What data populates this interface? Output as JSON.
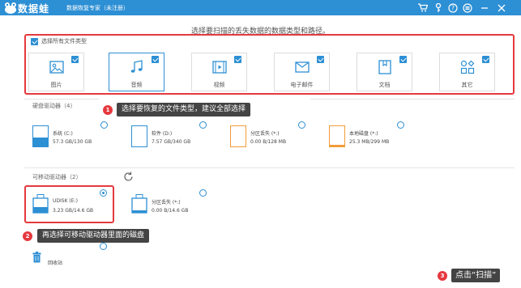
{
  "app": {
    "name": "数据蛙",
    "subtitle": "数据恢复专家（未注册）"
  },
  "heading": "选择要扫描的丢失数据的数据类型和路径。",
  "select_all": "选择所有文件类型",
  "file_types": [
    {
      "label": "图片",
      "icon": "image-icon",
      "checked": true
    },
    {
      "label": "音频",
      "icon": "audio-icon",
      "checked": true
    },
    {
      "label": "视频",
      "icon": "video-icon",
      "checked": true
    },
    {
      "label": "电子邮件",
      "icon": "email-icon",
      "checked": true
    },
    {
      "label": "文档",
      "icon": "document-icon",
      "checked": true
    },
    {
      "label": "其它",
      "icon": "other-icon",
      "checked": true
    }
  ],
  "hard_drives": {
    "title": "硬盘驱动器（4）",
    "items": [
      {
        "name": "系统 (C:)",
        "size": "57.3 GB/130 GB",
        "fill": 0.44,
        "color": "#2d8fd4"
      },
      {
        "name": "软件 (D:)",
        "size": "7.57 GB/340 GB",
        "fill": 0.02,
        "color": "#2d8fd4"
      },
      {
        "name": "分区丢失 (*:)",
        "size": "0.00 B/128 MB",
        "fill": 0.0,
        "color": "#f39c3a"
      },
      {
        "name": "本地磁盘 (*:)",
        "size": "25.3 MB/299 MB",
        "fill": 0.08,
        "color": "#f39c3a"
      }
    ]
  },
  "removable": {
    "title": "可移动驱动器（2）",
    "items": [
      {
        "name": "UDISK (E:)",
        "size": "3.23 GB/14.6 GB",
        "fill": 0.22,
        "selected": true
      },
      {
        "name": "分区丢失 (*:)",
        "size": "0.00 B/14.6 GB",
        "fill": 0.0,
        "selected": false
      }
    ]
  },
  "recycle_bin": "回收站",
  "callouts": [
    {
      "num": "1",
      "text": "选择要恢复的文件类型，建议全部选择"
    },
    {
      "num": "2",
      "text": "再选择可移动驱动器里面的磁盘"
    },
    {
      "num": "3",
      "text": "点击“扫描”"
    }
  ]
}
